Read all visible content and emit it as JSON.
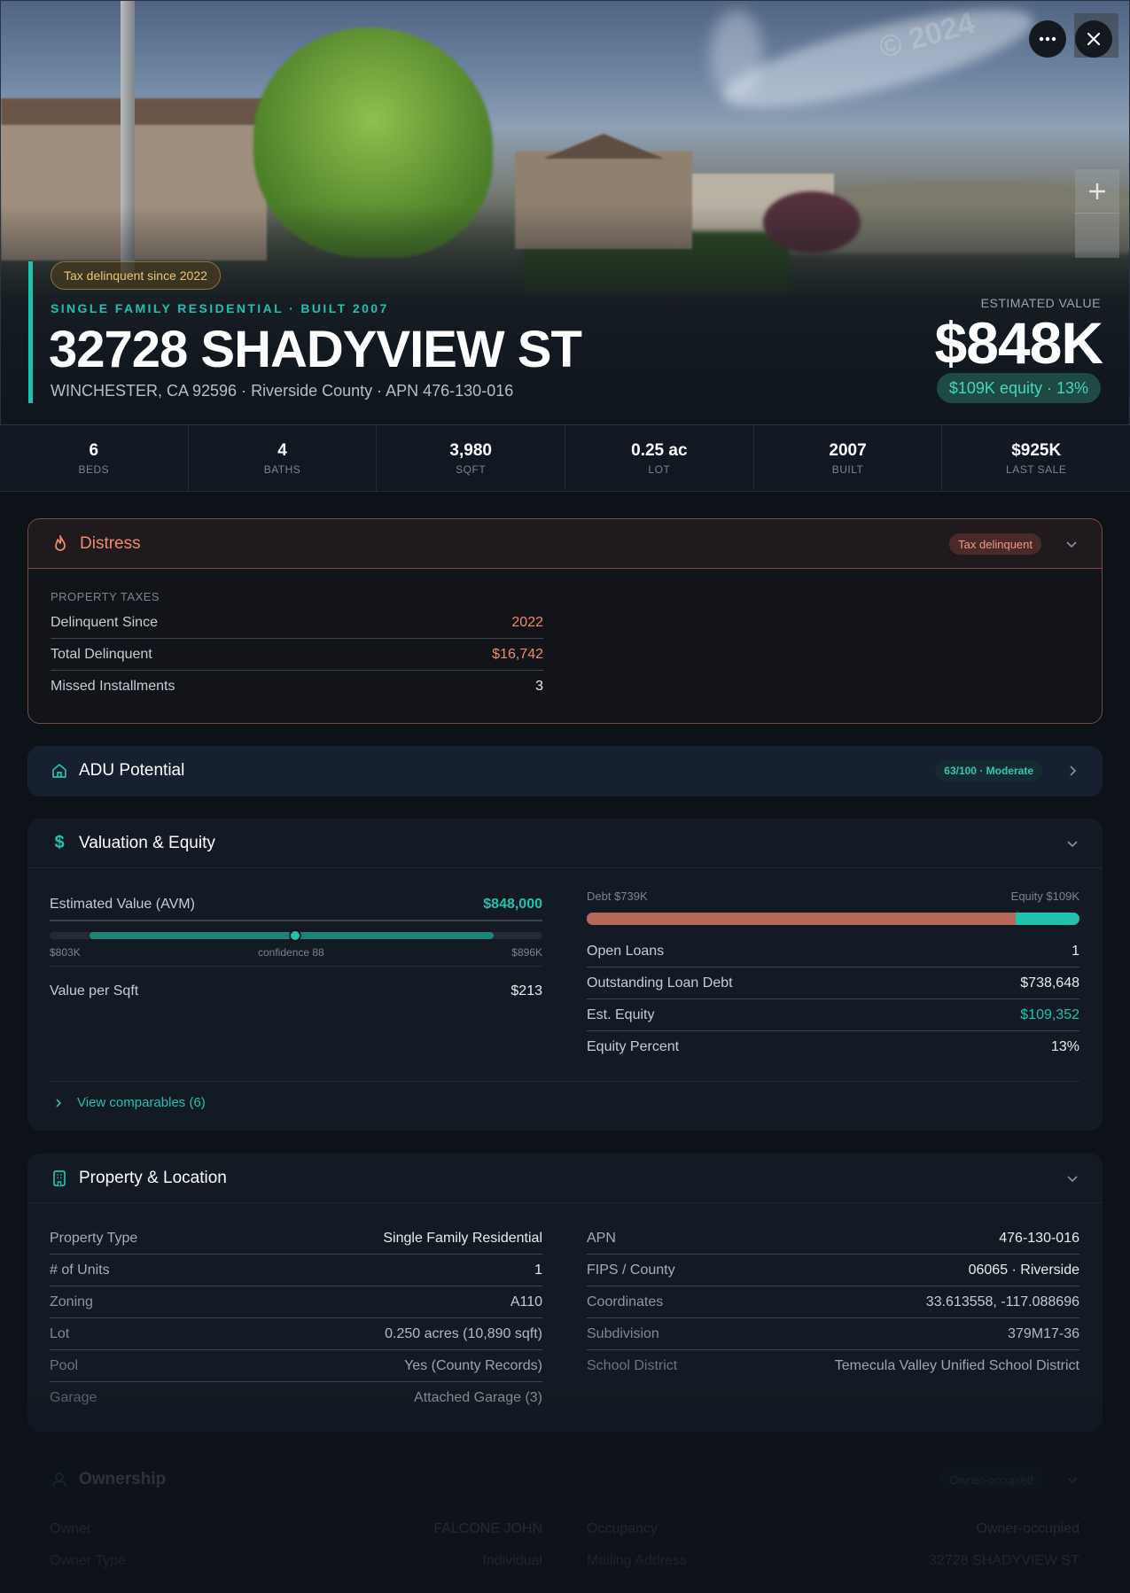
{
  "hero": {
    "tax_pill": "Tax delinquent since 2022",
    "property_type": "SINGLE FAMILY RESIDENTIAL · BUILT 2007",
    "address": "32728 SHADYVIEW ST",
    "subaddress": "WINCHESTER, CA 92596 · Riverside County · APN 476-130-016",
    "est_label": "ESTIMATED VALUE",
    "est_value": "$848K",
    "equity_pill": "$109K equity · 13%",
    "image_watermark": "© 2024"
  },
  "stats": [
    {
      "value": "6",
      "label": "BEDS"
    },
    {
      "value": "4",
      "label": "BATHS"
    },
    {
      "value": "3,980",
      "label": "SQFT"
    },
    {
      "value": "0.25 ac",
      "label": "LOT"
    },
    {
      "value": "2007",
      "label": "BUILT"
    },
    {
      "value": "$925K",
      "label": "LAST SALE"
    }
  ],
  "distress": {
    "title": "Distress",
    "badge": "Tax delinquent",
    "section": "PROPERTY TAXES",
    "rows": [
      {
        "k": "Delinquent Since",
        "v": "2022"
      },
      {
        "k": "Total Delinquent",
        "v": "$16,742"
      },
      {
        "k": "Missed Installments",
        "v": "3"
      }
    ]
  },
  "adu": {
    "title": "ADU Potential",
    "badge": "63/100 · Moderate"
  },
  "valuation": {
    "title": "Valuation & Equity",
    "avm_label": "Estimated Value (AVM)",
    "avm_value": "$848,000",
    "range_low": "$803K",
    "range_mid": "confidence 88",
    "range_high": "$896K",
    "confidence": 88,
    "vps_label": "Value per Sqft",
    "vps_value": "$213",
    "debt_label": "Debt $739K",
    "equity_label": "Equity $109K",
    "debt_fraction": 0.87,
    "rows": [
      {
        "k": "Open Loans",
        "v": "1"
      },
      {
        "k": "Outstanding Loan Debt",
        "v": "$738,648"
      },
      {
        "k": "Est. Equity",
        "v": "$109,352"
      },
      {
        "k": "Equity Percent",
        "v": "13%"
      }
    ],
    "comparables_link": "View comparables (6)"
  },
  "property": {
    "title": "Property & Location",
    "left": [
      {
        "k": "Property Type",
        "v": "Single Family Residential"
      },
      {
        "k": "# of Units",
        "v": "1"
      },
      {
        "k": "Zoning",
        "v": "A110"
      },
      {
        "k": "Lot",
        "v": "0.250 acres (10,890 sqft)"
      },
      {
        "k": "Pool",
        "v": "Yes (County Records)"
      },
      {
        "k": "Garage",
        "v": "Attached Garage (3)"
      }
    ],
    "right": [
      {
        "k": "APN",
        "v": "476-130-016"
      },
      {
        "k": "FIPS / County",
        "v": "06065 · Riverside"
      },
      {
        "k": "Coordinates",
        "v": "33.613558, -117.088696"
      },
      {
        "k": "Subdivision",
        "v": "379M17-36"
      },
      {
        "k": "School District",
        "v": "Temecula Valley Unified School District"
      }
    ]
  },
  "ownership": {
    "title": "Ownership",
    "badge": "Owner-occupied",
    "left": [
      {
        "k": "Owner",
        "v": "FALCONE JOHN"
      },
      {
        "k": "Owner Type",
        "v": "Individual"
      }
    ],
    "right": [
      {
        "k": "Occupancy",
        "v": "Owner-occupied"
      },
      {
        "k": "Mailing Address",
        "v": "32728 SHADYVIEW ST"
      }
    ]
  },
  "colors": {
    "accent": "#21c2ad",
    "distress": "#ef8a70",
    "debt": "#b9675a",
    "background": "#0d1219"
  }
}
